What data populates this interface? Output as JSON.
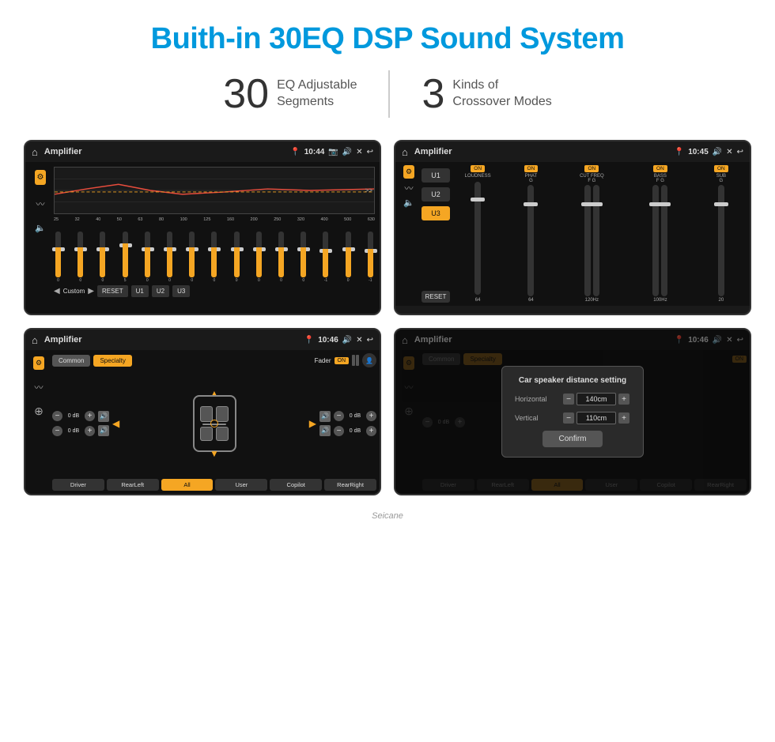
{
  "page": {
    "title": "Buith-in 30EQ DSP Sound System"
  },
  "stats": [
    {
      "number": "30",
      "label": "EQ Adjustable\nSegments"
    },
    {
      "number": "3",
      "label": "Kinds of\nCrossover Modes"
    }
  ],
  "screens": [
    {
      "id": "screen-eq",
      "topbar": {
        "title": "Amplifier",
        "time": "10:44"
      },
      "freqs": [
        "25",
        "32",
        "40",
        "50",
        "63",
        "80",
        "100",
        "125",
        "160",
        "200",
        "250",
        "320",
        "400",
        "500",
        "630"
      ],
      "sliderValues": [
        "0",
        "0",
        "0",
        "5",
        "0",
        "0",
        "0",
        "0",
        "0",
        "0",
        "0",
        "0",
        "-1",
        "0",
        "-1"
      ],
      "buttons": [
        "RESET",
        "U1",
        "U2",
        "U3"
      ],
      "presetLabel": "Custom"
    },
    {
      "id": "screen-crossover",
      "topbar": {
        "title": "Amplifier",
        "time": "10:45"
      },
      "presets": [
        "U1",
        "U2",
        "U3"
      ],
      "activePreset": "U3",
      "channels": [
        {
          "name": "LOUDNESS",
          "on": true
        },
        {
          "name": "PHAT",
          "on": true
        },
        {
          "name": "CUT FREQ",
          "on": true
        },
        {
          "name": "BASS",
          "on": true
        },
        {
          "name": "SUB",
          "on": true
        }
      ],
      "resetLabel": "RESET"
    },
    {
      "id": "screen-speaker",
      "topbar": {
        "title": "Amplifier",
        "time": "10:46"
      },
      "tabs": [
        "Common",
        "Specialty"
      ],
      "activeTab": "Specialty",
      "faderLabel": "Fader",
      "faderOn": true,
      "dbValues": [
        "0 dB",
        "0 dB",
        "0 dB",
        "0 dB"
      ],
      "bottomButtons": [
        "Driver",
        "RearLeft",
        "All",
        "User",
        "Copilot",
        "RearRight"
      ]
    },
    {
      "id": "screen-dialog",
      "topbar": {
        "title": "Amplifier",
        "time": "10:46"
      },
      "dialogTitle": "Car speaker distance setting",
      "rows": [
        {
          "label": "Horizontal",
          "value": "140cm"
        },
        {
          "label": "Vertical",
          "value": "110cm"
        }
      ],
      "confirmLabel": "Confirm"
    }
  ],
  "watermark": "Seicane"
}
